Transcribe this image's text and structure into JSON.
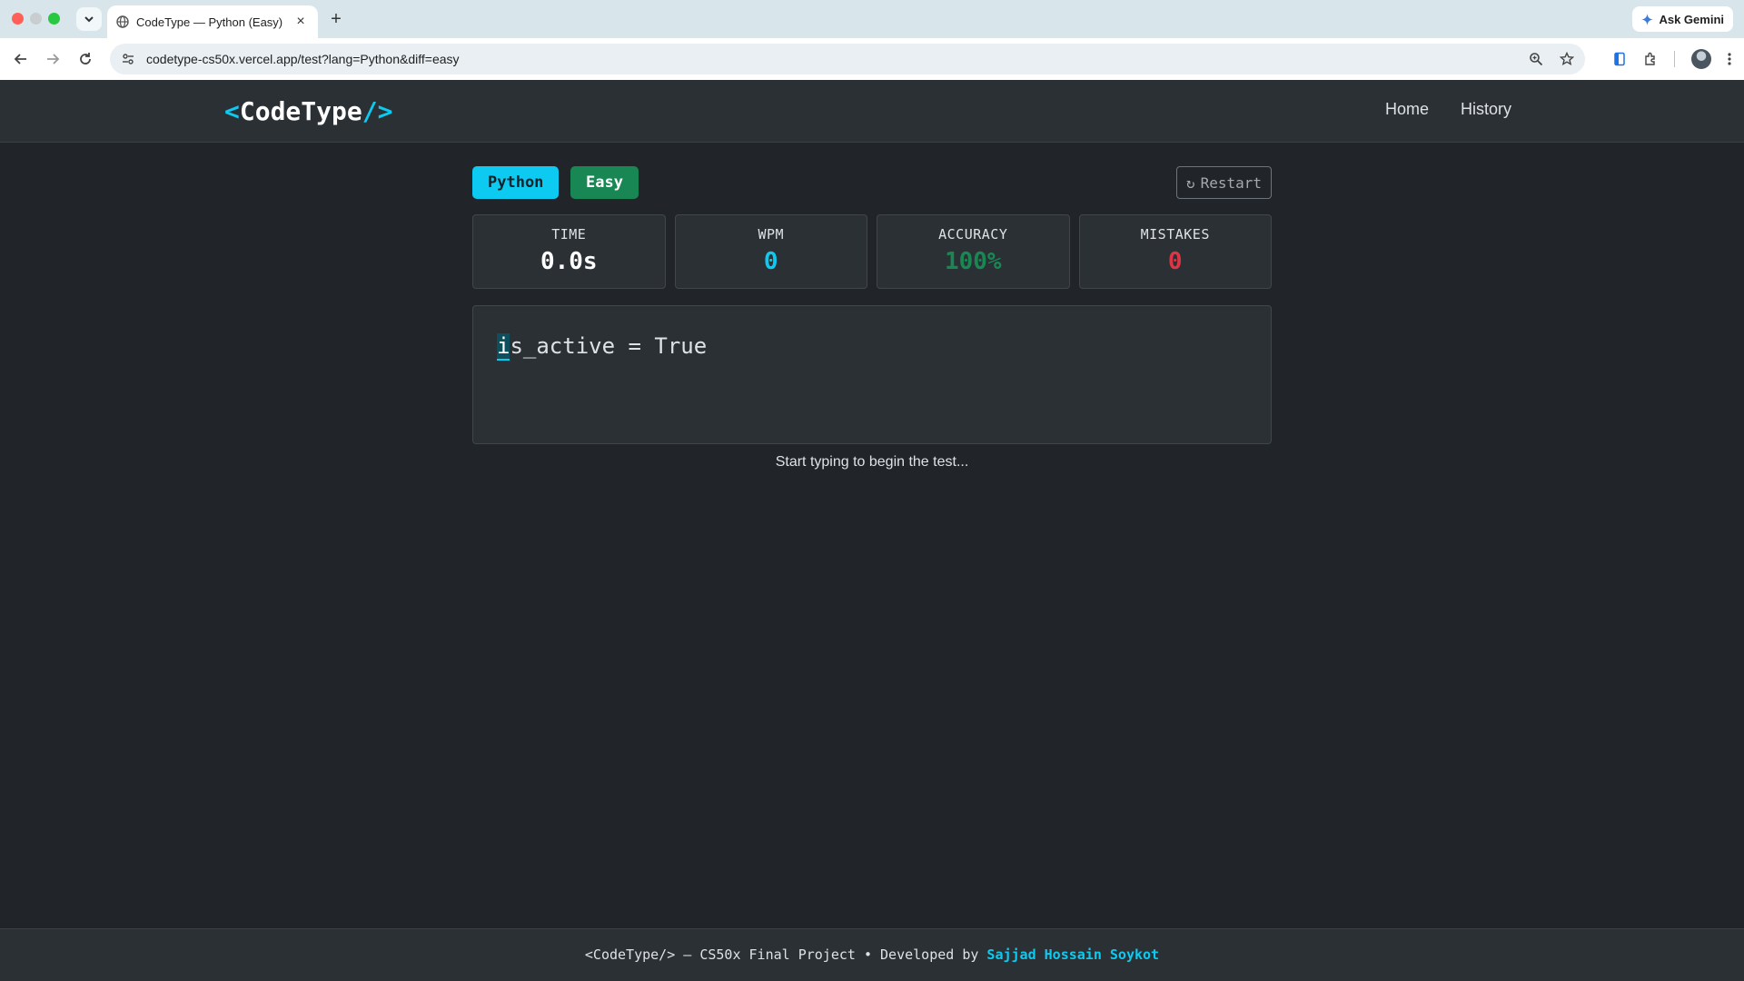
{
  "browser": {
    "tab_title": "CodeType — Python (Easy)",
    "url": "codetype-cs50x.vercel.app/test?lang=Python&diff=easy",
    "ask_gemini": "Ask Gemini"
  },
  "header": {
    "logo_open": "<",
    "logo_text": "CodeType",
    "logo_close": "/>",
    "nav": {
      "home": "Home",
      "history": "History"
    }
  },
  "test": {
    "language": "Python",
    "difficulty": "Easy",
    "restart_label": "Restart",
    "restart_icon": "↻"
  },
  "stats": {
    "time": {
      "label": "TIME",
      "value": "0.0s",
      "color": "#ffffff"
    },
    "wpm": {
      "label": "WPM",
      "value": "0",
      "color": "#0dcaf0"
    },
    "accuracy": {
      "label": "ACCURACY",
      "value": "100%",
      "color": "#198754"
    },
    "mistakes": {
      "label": "MISTAKES",
      "value": "0",
      "color": "#dc3545"
    }
  },
  "code": {
    "current_char": "i",
    "remaining": "s_active = True"
  },
  "hint": "Start typing to begin the test...",
  "footer": {
    "text": "<CodeType/> — CS50x Final Project • Developed by ",
    "author": "Sajjad Hossain Soykot"
  }
}
